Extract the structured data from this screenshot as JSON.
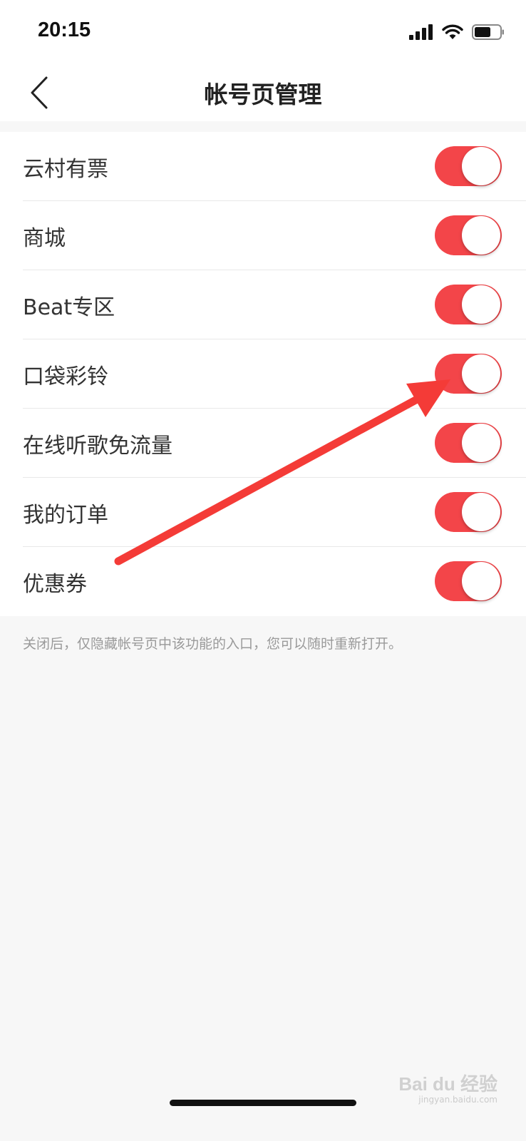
{
  "status_bar": {
    "time": "20:15",
    "icons": [
      "signal-icon",
      "wifi-icon",
      "battery-icon"
    ]
  },
  "nav": {
    "title": "帐号页管理",
    "back_icon": "chevron-left-icon"
  },
  "items": [
    {
      "label": "云村有票",
      "enabled": true
    },
    {
      "label": "商城",
      "enabled": true
    },
    {
      "label": "Beat专区",
      "enabled": true
    },
    {
      "label": "口袋彩铃",
      "enabled": true
    },
    {
      "label": "在线听歌免流量",
      "enabled": true
    },
    {
      "label": "我的订单",
      "enabled": true
    },
    {
      "label": "优惠券",
      "enabled": true
    }
  ],
  "footnote": "关闭后，仅隐藏帐号页中该功能的入口，您可以随时重新打开。",
  "watermark": {
    "brand": "Bai du 经验",
    "url": "jingyan.baidu.com"
  },
  "colors": {
    "toggle_on": "#f34549",
    "annotation_arrow": "#f43b37",
    "background": "#f7f7f7"
  }
}
